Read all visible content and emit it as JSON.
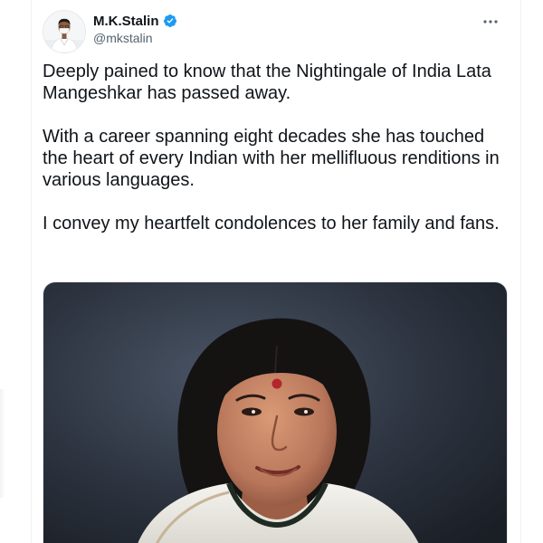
{
  "tweet": {
    "author": {
      "display_name": "M.K.Stalin",
      "handle": "@mkstalin",
      "verified": true,
      "avatar_icon": "profile-photo"
    },
    "more_icon": "more-horizontal-icon",
    "paragraphs": [
      "Deeply pained to know that the Nightingale of India Lata Mangeshkar has passed away.",
      "With a career spanning eight decades she has touched the heart of every Indian with her mellifluous renditions in various languages.",
      "I convey my heartfelt condolences to her family and fans."
    ],
    "media_icon": "portrait-photo"
  },
  "colors": {
    "text_primary": "#0f1419",
    "text_secondary": "#536471",
    "verified_blue": "#1d9bf0",
    "border": "#eff3f4"
  }
}
